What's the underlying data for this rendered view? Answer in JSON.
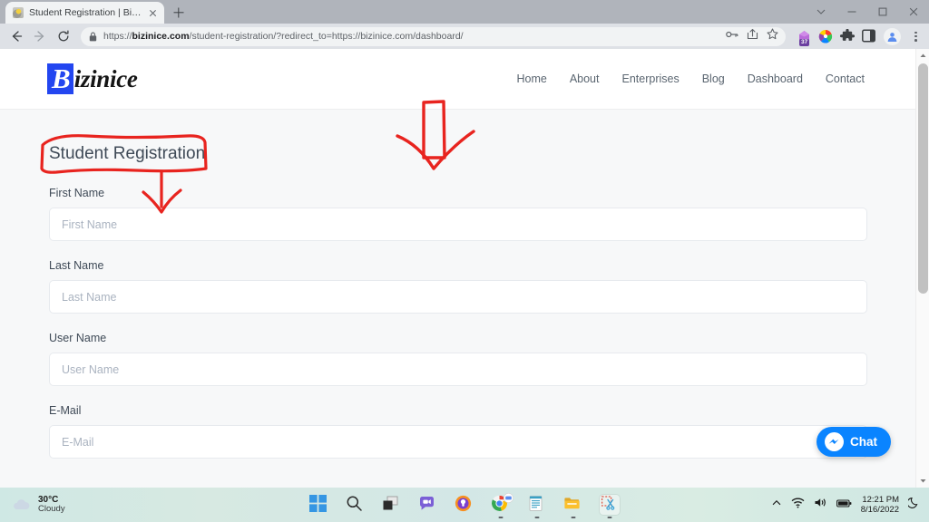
{
  "browser": {
    "tab": {
      "title": "Student Registration | Bizinice",
      "favicon": "site-favicon",
      "close": "×"
    },
    "new_tab_tooltip": "New tab",
    "window_controls": {
      "tab_search": "tab-search",
      "minimize": "minimize",
      "maximize": "maximize",
      "close": "close"
    },
    "nav": {
      "back": "back-arrow",
      "forward": "forward-arrow",
      "reload": "reload"
    },
    "omnibox": {
      "lock": "lock-icon",
      "url_full": "https://bizinice.com/student-registration/?redirect_to=https://bizinice.com/dashboard/",
      "url_prefix": "https://",
      "url_domain": "bizinice.com",
      "url_suffix": "/student-registration/?redirect_to=https://bizinice.com/dashboard/",
      "key_icon": "password-key-icon",
      "share_icon": "share-icon",
      "bookmark_icon": "star-icon"
    },
    "extensions": [
      {
        "name": "grammar-extension",
        "badge": "37",
        "color": "#b96ad9"
      },
      {
        "name": "color-wheel-extension",
        "badge": "",
        "color": "#ff5a3c"
      },
      {
        "name": "puzzle-extensions-icon",
        "badge": "",
        "color": "#3c4043"
      },
      {
        "name": "side-panel-icon",
        "badge": "",
        "color": "#3c4043"
      }
    ],
    "profile_avatar": "profile-avatar",
    "menu": "three-dot-menu"
  },
  "site": {
    "logo": {
      "mark": "B",
      "rest": "izinice",
      "mark_color": "#2346f0"
    },
    "nav": [
      {
        "label": "Home"
      },
      {
        "label": "About"
      },
      {
        "label": "Enterprises"
      },
      {
        "label": "Blog"
      },
      {
        "label": "Dashboard"
      },
      {
        "label": "Contact"
      }
    ]
  },
  "form": {
    "title": "Student Registration",
    "fields": [
      {
        "label": "First Name",
        "placeholder": "First Name",
        "value": ""
      },
      {
        "label": "Last Name",
        "placeholder": "Last Name",
        "value": ""
      },
      {
        "label": "User Name",
        "placeholder": "User Name",
        "value": ""
      },
      {
        "label": "E-Mail",
        "placeholder": "E-Mail",
        "value": ""
      }
    ]
  },
  "chat_widget": {
    "label": "Chat",
    "icon": "messenger-icon",
    "color": "#0a84ff"
  },
  "annotations": {
    "color": "#e8241f",
    "title_box": "red-rectangle-around-student-registration",
    "title_arrow": "red-down-arrow-under-title",
    "page_arrow": "large-red-down-arrow"
  },
  "taskbar": {
    "weather": {
      "temp": "30°C",
      "condition": "Cloudy",
      "icon": "cloud-icon"
    },
    "items": [
      {
        "name": "start-button",
        "running": false
      },
      {
        "name": "search-icon",
        "running": false
      },
      {
        "name": "task-view-icon",
        "running": false
      },
      {
        "name": "chat-teams-icon",
        "running": false
      },
      {
        "name": "browser-icon",
        "running": false
      },
      {
        "name": "chrome-icon",
        "running": true
      },
      {
        "name": "notepad-icon",
        "running": true
      },
      {
        "name": "file-explorer-icon",
        "running": true
      },
      {
        "name": "snipping-tool-icon",
        "running": true
      }
    ],
    "tray": {
      "overflow": "chevron-up-icon",
      "wifi": "wifi-icon",
      "volume": "volume-icon",
      "battery": "battery-icon",
      "time": "12:21 PM",
      "date": "8/16/2022",
      "notifications": "moon-icon"
    }
  }
}
